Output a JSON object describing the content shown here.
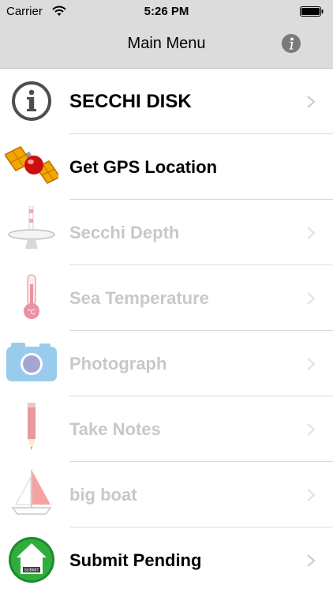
{
  "status_bar": {
    "carrier": "Carrier",
    "time": "5:26 PM"
  },
  "nav": {
    "title": "Main Menu"
  },
  "menu": [
    {
      "label": "SECCHI DISK",
      "icon": "info-circle-icon"
    },
    {
      "label": "Get GPS Location",
      "icon": "satellite-icon"
    },
    {
      "label": "Secchi Depth",
      "icon": "secchi-disk-icon",
      "disabled": true
    },
    {
      "label": "Sea Temperature",
      "icon": "thermometer-icon",
      "disabled": true
    },
    {
      "label": "Photograph",
      "icon": "camera-icon",
      "disabled": true
    },
    {
      "label": "Take Notes",
      "icon": "pencil-icon",
      "disabled": true
    },
    {
      "label": "big boat",
      "icon": "sailboat-icon",
      "disabled": true
    },
    {
      "label": "Submit Pending",
      "icon": "submit-house-icon",
      "badge": "SUBMIT"
    }
  ]
}
